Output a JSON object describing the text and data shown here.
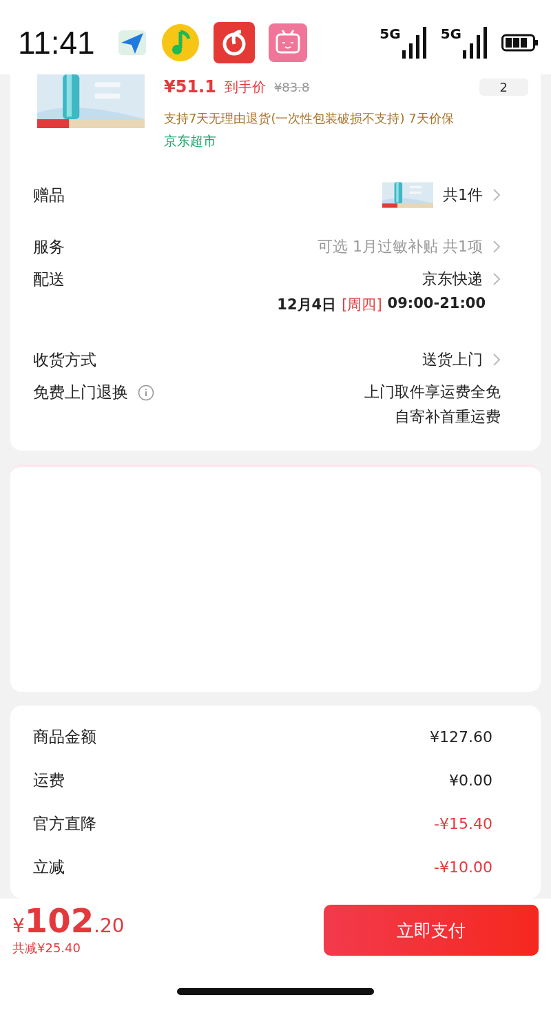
{
  "status_bar": {
    "time": "11:41",
    "signals": [
      {
        "label": "5G"
      },
      {
        "label": "5G"
      }
    ]
  },
  "product": {
    "price": "¥51.1",
    "price_label": "到手价",
    "original_price": "¥83.8",
    "quantity": "2",
    "policy": "支持7天无理由退货(一次性包装破损不支持)  7天价保",
    "store": "京东超市"
  },
  "details": [
    {
      "kind": "gift",
      "label": "赠品",
      "value": "共1件",
      "chevron": true
    },
    {
      "kind": "plain",
      "label": "服务",
      "value": "可选 1月过敏补贴 共1项",
      "chevron": true
    },
    {
      "kind": "delivery",
      "label": "配送",
      "value": "京东快递",
      "date": "12月4日",
      "weekday": "[周四]",
      "time": "09:00-21:00",
      "chevron": true
    },
    {
      "kind": "plain",
      "label": "收货方式",
      "value": "送货上门",
      "chevron": true
    },
    {
      "kind": "info",
      "label": "免费上门退换",
      "lines": [
        "上门取件享运费全免",
        "自寄补首重运费"
      ],
      "chevron": false
    }
  ],
  "summary": [
    {
      "label": "商品金额",
      "value": "¥127.60",
      "discount": false
    },
    {
      "label": "运费",
      "value": "¥0.00",
      "discount": false
    },
    {
      "label": "官方直降",
      "value": "-¥15.40",
      "discount": true
    },
    {
      "label": "立减",
      "value": "-¥10.00",
      "discount": true
    }
  ],
  "footer": {
    "currency": "¥",
    "integer": "102",
    "decimal": ".20",
    "savings": "共减¥25.40",
    "pay_button": "立即支付"
  }
}
